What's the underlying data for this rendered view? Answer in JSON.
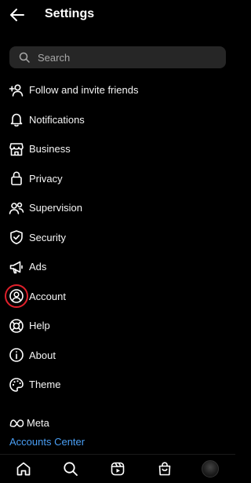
{
  "header": {
    "title": "Settings"
  },
  "search": {
    "placeholder": "Search"
  },
  "menu": {
    "items": [
      {
        "label": "Follow and invite friends",
        "icon": "add-person-icon"
      },
      {
        "label": "Notifications",
        "icon": "bell-icon"
      },
      {
        "label": "Business",
        "icon": "shop-icon"
      },
      {
        "label": "Privacy",
        "icon": "lock-icon"
      },
      {
        "label": "Supervision",
        "icon": "people-icon"
      },
      {
        "label": "Security",
        "icon": "shield-icon"
      },
      {
        "label": "Ads",
        "icon": "megaphone-icon"
      },
      {
        "label": "Account",
        "icon": "user-circle-icon",
        "highlighted": true
      },
      {
        "label": "Help",
        "icon": "lifebuoy-icon"
      },
      {
        "label": "About",
        "icon": "info-icon"
      },
      {
        "label": "Theme",
        "icon": "palette-icon"
      }
    ]
  },
  "footer": {
    "meta_label": "Meta",
    "accounts_center": "Accounts Center"
  },
  "bottom_nav": {
    "items": [
      "home-icon",
      "search-icon",
      "reels-icon",
      "shop-bag-icon",
      "profile-avatar"
    ]
  },
  "colors": {
    "background": "#000000",
    "text": "#f5f5f5",
    "search_bg": "#262626",
    "link": "#4a9ff5",
    "highlight_ring": "#e0202b"
  }
}
